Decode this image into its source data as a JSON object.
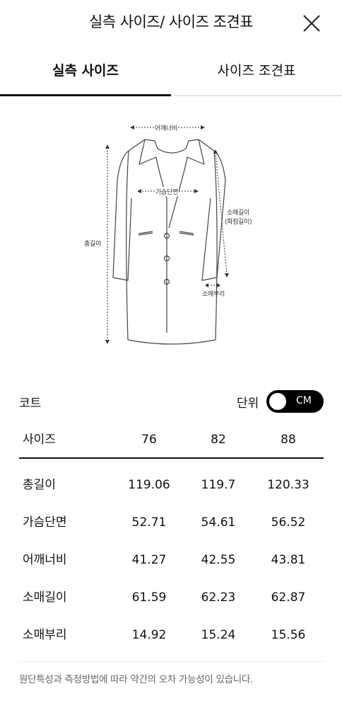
{
  "header": {
    "title": "실측 사이즈/ 사이즈 조견표"
  },
  "tabs": [
    {
      "label": "실측 사이즈"
    },
    {
      "label": "사이즈 조견표"
    }
  ],
  "diagram": {
    "labels": {
      "shoulder": "어깨너비",
      "chest": "가슴단면",
      "sleeve_line1": "소매길이",
      "sleeve_line2": "(화장길이)",
      "total": "총길이",
      "cuff": "소매부리"
    }
  },
  "category": "코트",
  "unit": {
    "label": "단위",
    "value": "CM"
  },
  "table": {
    "header": [
      "사이즈",
      "76",
      "82",
      "88"
    ],
    "rows": [
      [
        "총길이",
        "119.06",
        "119.7",
        "120.33"
      ],
      [
        "가슴단면",
        "52.71",
        "54.61",
        "56.52"
      ],
      [
        "어깨너비",
        "41.27",
        "42.55",
        "43.81"
      ],
      [
        "소매길이",
        "61.59",
        "62.23",
        "62.87"
      ],
      [
        "소매부리",
        "14.92",
        "15.24",
        "15.56"
      ]
    ]
  },
  "notice": "원단특성과 측정방법에 따라 약간의 오차 가능성이 있습니다."
}
